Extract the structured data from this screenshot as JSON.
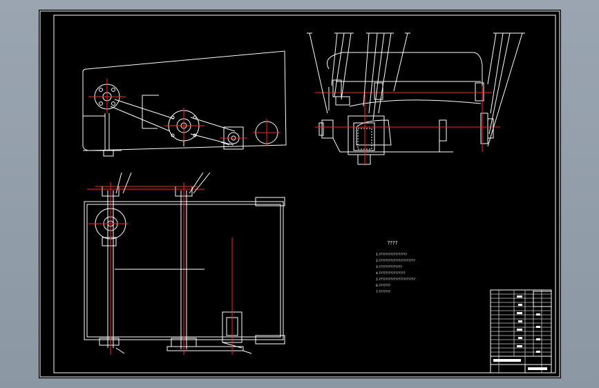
{
  "drawing": {
    "notes_title": "????",
    "notes": [
      "1.?????????????????",
      "2.??????????????????????",
      "3.??????????????",
      "4.????????????????",
      "5.??????????????????????",
      "6.???????",
      "7.???????"
    ]
  },
  "colors": {
    "background": "#000000",
    "line": "#ffffff",
    "centerline": "#ff2222",
    "frame_bg": "#9aa5b1"
  }
}
